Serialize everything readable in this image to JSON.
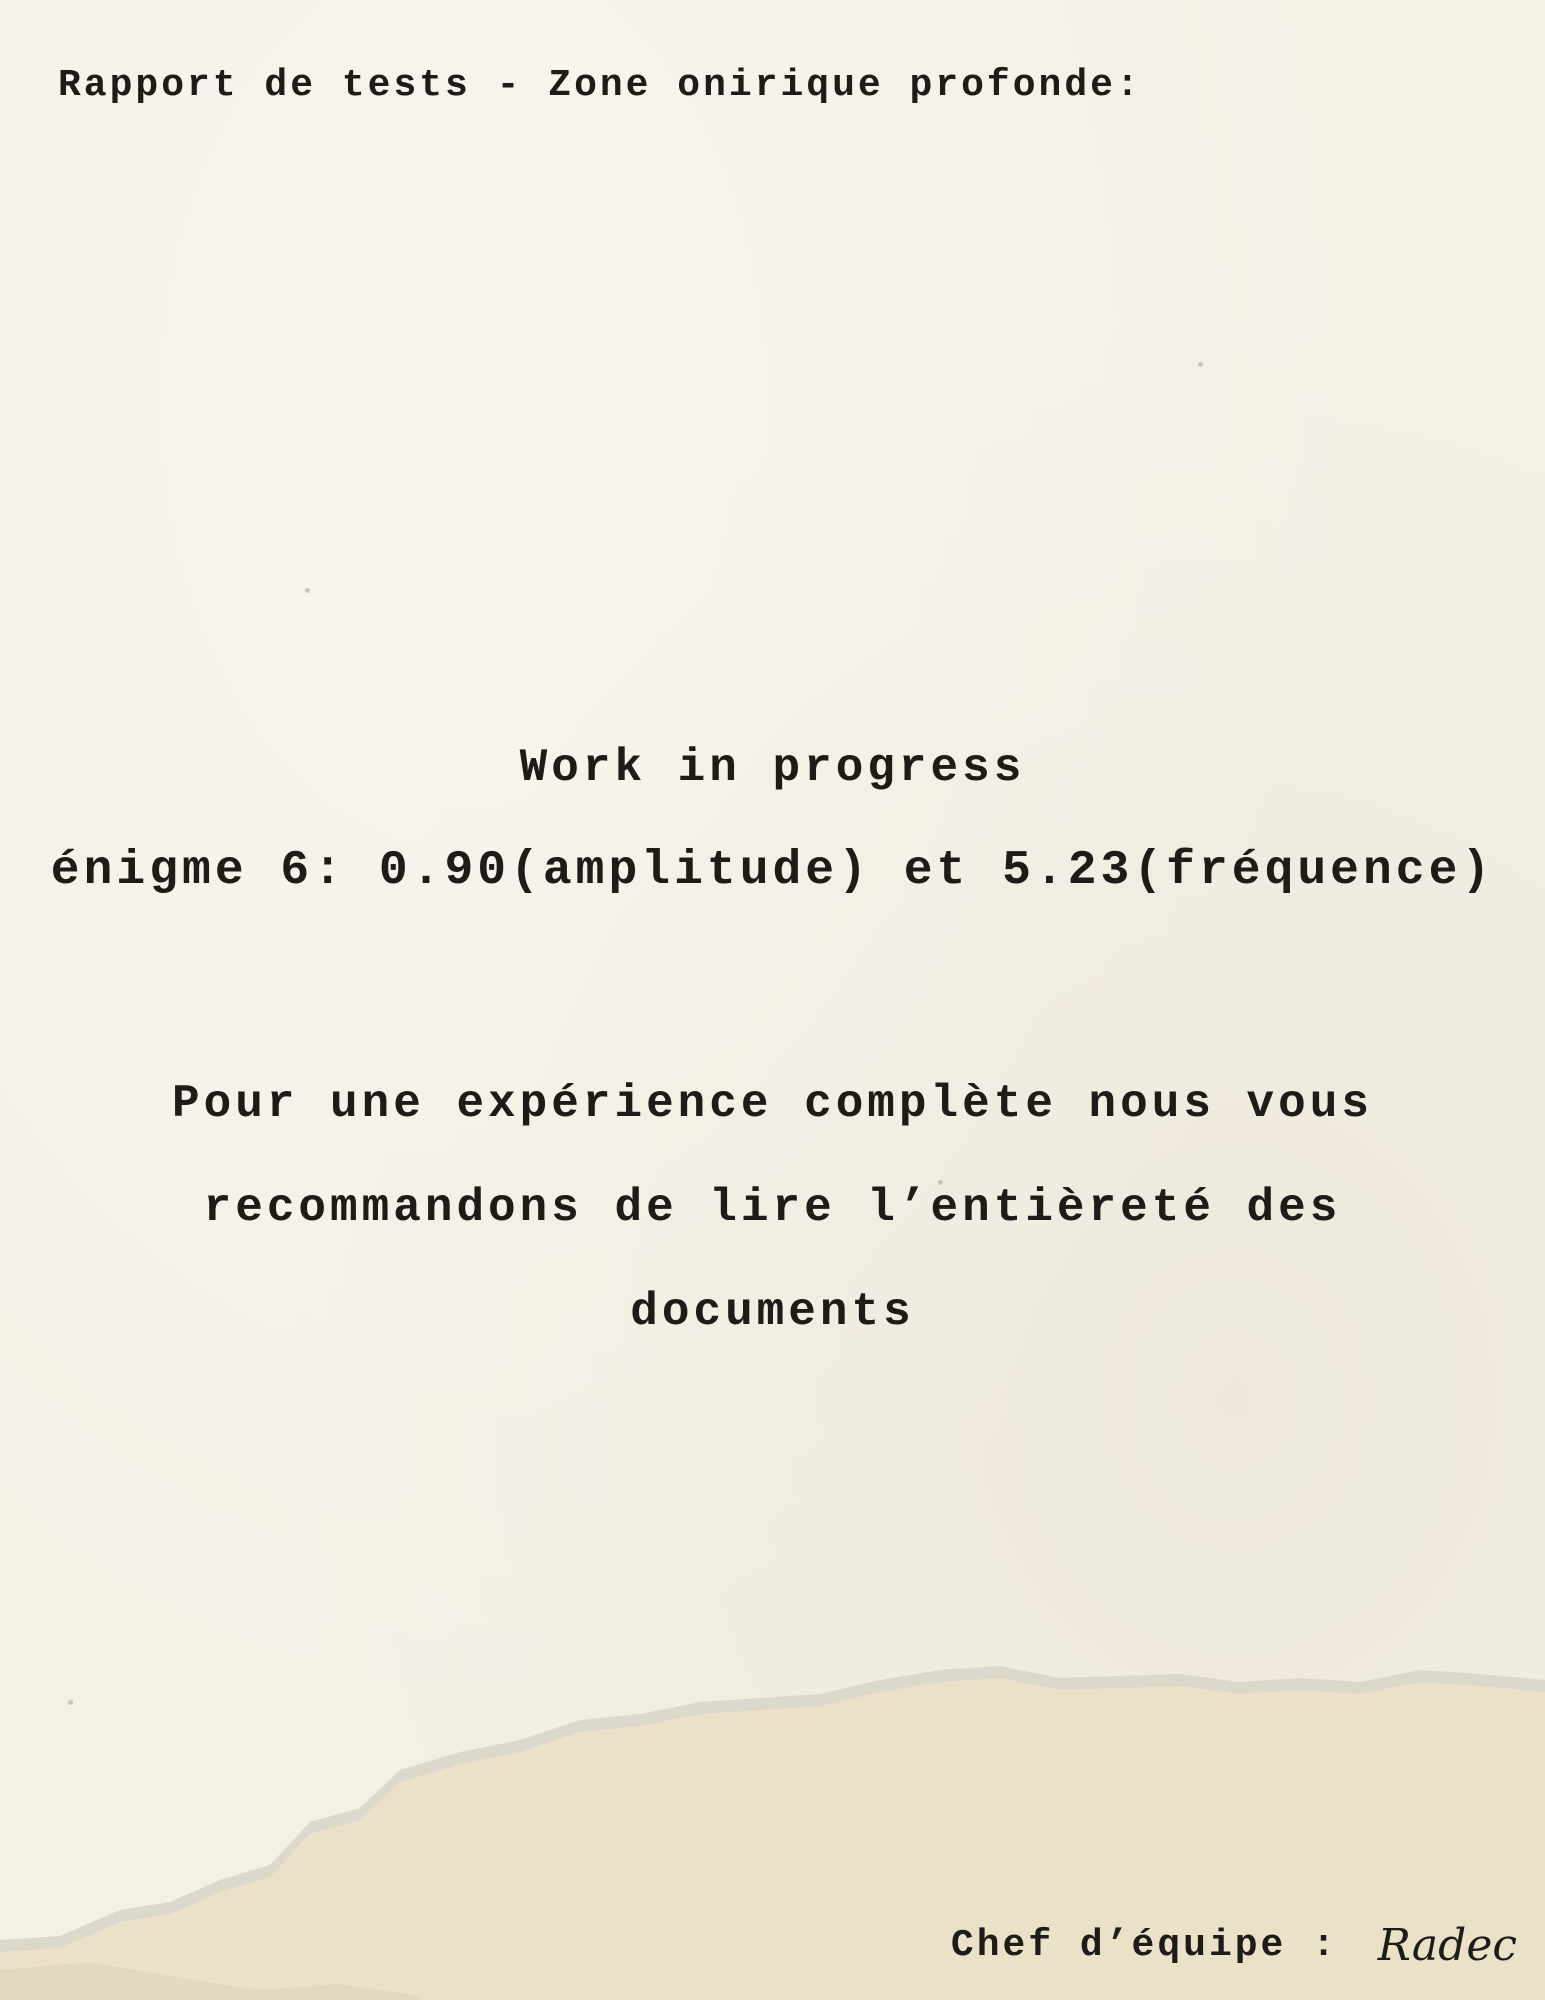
{
  "document": {
    "header": "Rapport de tests - Zone onirique profonde:",
    "status": "Work in progress",
    "enigme": "énigme 6: 0.90(amplitude) et 5.23(fréquence)",
    "paragraph": "Pour une expérience complète nous vous recommandons de lire l’entièreté des documents",
    "signature": {
      "label": "Chef d’équipe :",
      "name": "Radec"
    }
  },
  "colors": {
    "paper": "#f4f0e6",
    "torn_paper": "#ebe1c6",
    "ink": "#1e1c19"
  }
}
